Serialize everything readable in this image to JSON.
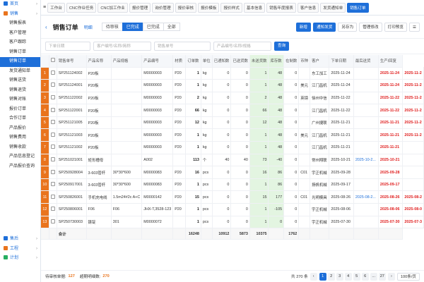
{
  "sidebar": {
    "items": [
      {
        "label": "首页",
        "type": "group",
        "icon": "home-icon"
      },
      {
        "label": "销售",
        "type": "group",
        "icon": "cart-icon"
      },
      {
        "label": "销售报表",
        "type": "sub"
      },
      {
        "label": "客户管理",
        "type": "sub"
      },
      {
        "label": "客户跟踪",
        "type": "sub"
      },
      {
        "label": "销售订单",
        "type": "sub"
      },
      {
        "label": "销售订单",
        "type": "sub",
        "active": true
      },
      {
        "label": "发货通知单",
        "type": "sub"
      },
      {
        "label": "销售送货",
        "type": "sub"
      },
      {
        "label": "销售退货",
        "type": "sub"
      },
      {
        "label": "销售对账",
        "type": "sub"
      },
      {
        "label": "报价订单",
        "type": "sub"
      },
      {
        "label": "合作订单",
        "type": "sub"
      },
      {
        "label": "产品报价",
        "type": "sub"
      },
      {
        "label": "销售费用",
        "type": "sub"
      },
      {
        "label": "销售收款",
        "type": "sub"
      },
      {
        "label": "产品信息登记",
        "type": "sub"
      },
      {
        "label": "产品报价查询",
        "type": "sub"
      }
    ],
    "bottom": [
      {
        "label": "售后",
        "icon": "service-icon"
      },
      {
        "label": "工程",
        "icon": "engineering-icon"
      },
      {
        "label": "计划",
        "icon": "plan-icon"
      }
    ]
  },
  "topbar": {
    "tabs": [
      "工作台",
      "CNC作业任务",
      "CNC加工作业",
      "报价管理",
      "询价管理",
      "报价审核",
      "报价模板",
      "报价样式",
      "基本信息",
      "销售年度报表",
      "客户信息",
      "发货通知单",
      "销售订单"
    ]
  },
  "header": {
    "title": "销售订单",
    "view_label": "明细",
    "filters": [
      "待审核",
      "已完成",
      "已完成",
      "全部"
    ],
    "active_filter": 1,
    "buttons": [
      "新增",
      "通知发货",
      "另存为",
      "管理修改",
      "打印预览"
    ]
  },
  "filterbar": {
    "date": "下单日期",
    "customer": "客户编号/名称/简称",
    "order_no": "销售单号",
    "product": "产品编号/名称/规格",
    "search_label": "查询"
  },
  "table": {
    "columns": [
      "",
      "",
      "销售单号",
      "产品名称",
      "产品规格",
      "产品编号",
      "材质",
      "订单数",
      "单位",
      "已通知数",
      "已送货数",
      "未送货数",
      "库存数",
      "在制数",
      "币种",
      "客户",
      "下单日期",
      "最后送货",
      "生产/回复"
    ],
    "rows": [
      {
        "rn": "1",
        "no": "SP251124002",
        "name": "P20板",
        "spec": "",
        "code": "M0000003",
        "mat": "P20",
        "qty": "1",
        "unit": "kg",
        "notified": "0",
        "sent": "0",
        "unsent": "1",
        "stock": "48",
        "wip": "0",
        "cur": "",
        "cust": "东工加工",
        "date": "2025-11-24",
        "last": "",
        "due": "2025-11-24",
        "due2": "2025-11-2"
      },
      {
        "rn": "2",
        "no": "SP251124001",
        "name": "P20板",
        "spec": "",
        "code": "M0000003",
        "mat": "P20",
        "qty": "1",
        "unit": "kg",
        "notified": "0",
        "sent": "0",
        "unsent": "1",
        "stock": "48",
        "wip": "0",
        "cur": "美元",
        "cust": "江门昌机",
        "date": "2025-11-24",
        "last": "",
        "due": "2025-11-24",
        "due2": "2025-11-2"
      },
      {
        "rn": "3",
        "no": "SP251122002",
        "name": "P20板",
        "spec": "",
        "code": "M0000003",
        "mat": "P20",
        "qty": "2",
        "unit": "kg",
        "notified": "0",
        "sent": "0",
        "unsent": "2",
        "stock": "48",
        "wip": "0",
        "cur": "英镑",
        "cust": "徐州中信",
        "date": "2025-11-22",
        "last": "",
        "due": "2025-11-22",
        "due2": "2025-11-2"
      },
      {
        "rn": "4",
        "no": "SP251122001",
        "name": "P20板",
        "spec": "",
        "code": "M0000003",
        "mat": "P20",
        "qty": "66",
        "unit": "kg",
        "notified": "0",
        "sent": "0",
        "unsent": "66",
        "stock": "48",
        "wip": "0",
        "cur": "",
        "cust": "江门昌机",
        "date": "2025-11-22",
        "last": "",
        "due": "2025-11-22",
        "due2": "2025-11-2"
      },
      {
        "rn": "5",
        "no": "SP251121005",
        "name": "P20板",
        "spec": "",
        "code": "M0000003",
        "mat": "P20",
        "qty": "12",
        "unit": "kg",
        "notified": "0",
        "sent": "0",
        "unsent": "12",
        "stock": "48",
        "wip": "0",
        "cur": "",
        "cust": "广州捷联",
        "date": "2025-11-21",
        "last": "",
        "due": "2025-11-21",
        "due2": "2025-11-2"
      },
      {
        "rn": "6",
        "no": "SP251121003",
        "name": "P20板",
        "spec": "",
        "code": "M0000003",
        "mat": "P20",
        "qty": "1",
        "unit": "kg",
        "notified": "0",
        "sent": "0",
        "unsent": "1",
        "stock": "48",
        "wip": "0",
        "cur": "美元",
        "cust": "江门昌机",
        "date": "2025-11-21",
        "last": "",
        "due": "2025-11-21",
        "due2": "2025-11-2"
      },
      {
        "rn": "7",
        "no": "SP251121002",
        "name": "P20板",
        "spec": "",
        "code": "M0000003",
        "mat": "P20",
        "qty": "1",
        "unit": "kg",
        "notified": "0",
        "sent": "0",
        "unsent": "1",
        "stock": "48",
        "wip": "0",
        "cur": "",
        "cust": "江门昌机",
        "date": "2025-11-21",
        "last": "",
        "due": "2025-11-21",
        "due2": ""
      },
      {
        "rn": "8",
        "no": "SP251021001",
        "name": "矩形槽母",
        "spec": "",
        "code": "A002",
        "mat": "",
        "qty": "113",
        "unit": "个",
        "notified": "40",
        "sent": "40",
        "unsent": "73",
        "stock": "-40",
        "wip": "0",
        "cur": "",
        "cust": "常州翔联",
        "date": "2025-10-21",
        "last": "2025-10-2...",
        "due": "2025-10-21",
        "due2": ""
      },
      {
        "rn": "9",
        "no": "SP250928004",
        "name": "3-603管杆",
        "spec": "30*30*600",
        "code": "M0000083",
        "mat": "P20",
        "qty": "16",
        "unit": "pcs",
        "notified": "0",
        "sent": "0",
        "unsent": "16",
        "stock": "86",
        "wip": "0",
        "cur": "C01",
        "cust": "宇正机械",
        "date": "2025-09-28",
        "last": "",
        "due": "2025-09-28",
        "due2": ""
      },
      {
        "rn": "10",
        "no": "SP250917001",
        "name": "3-603管杆",
        "spec": "30*30*600",
        "code": "M0000083",
        "mat": "P20",
        "qty": "1",
        "unit": "pcs",
        "notified": "0",
        "sent": "0",
        "unsent": "1",
        "stock": "86",
        "wip": "0",
        "cur": "",
        "cust": "扬帆机械",
        "date": "2025-09-17",
        "last": "",
        "due": "2025-09-17",
        "due2": ""
      },
      {
        "rn": "11",
        "no": "SP250826001",
        "name": "手机充电线",
        "spec": "1.5m24#2c A+C",
        "code": "M0000142",
        "mat": "P20",
        "qty": "15",
        "unit": "pcs",
        "notified": "0",
        "sent": "0",
        "unsent": "15",
        "stock": "177",
        "wip": "0",
        "cur": "C01",
        "cust": "光明模具",
        "date": "2025-08-26",
        "last": "2025-08-2...",
        "due": "2025-08-26",
        "due2": "2025-08-2"
      },
      {
        "rn": "12",
        "no": "SP250806001",
        "name": "F06",
        "spec": "F06",
        "code": "JHX-T,3528-123",
        "mat": "P20",
        "qty": "1",
        "unit": "pcs",
        "notified": "0",
        "sent": "0",
        "unsent": "1",
        "stock": "-105",
        "wip": "0",
        "cur": "",
        "cust": "宇正机械",
        "date": "2025-08-06",
        "last": "",
        "due": "2025-08-06",
        "due2": "2025-08-0"
      },
      {
        "rn": "13",
        "no": "SP250730003",
        "name": "铸锭",
        "spec": "301",
        "code": "M0000072",
        "mat": "",
        "qty": "1",
        "unit": "pcs",
        "notified": "0",
        "sent": "0",
        "unsent": "1",
        "stock": "0",
        "wip": "0",
        "cur": "",
        "cust": "宇正机械",
        "date": "2025-07-30",
        "last": "",
        "due": "2025-07-30",
        "due2": "2025-07-3"
      }
    ],
    "sum": {
      "label": "合计",
      "qty": "16248",
      "notified": "10912",
      "sent": "5873",
      "unsent": "10375",
      "wip": "1762"
    }
  },
  "footer": {
    "pending_label": "待审核单据:",
    "pending": "127",
    "overdue_label": "超期明细数:",
    "overdue": "270",
    "total": "共 270 条",
    "pages": [
      "1",
      "2",
      "3",
      "4",
      "5",
      "6",
      "...",
      "27"
    ],
    "page_size": "100条/页"
  },
  "colors": {
    "accent": "#1e6fd9",
    "row_num": "#e9741d",
    "due": "#e02020"
  }
}
